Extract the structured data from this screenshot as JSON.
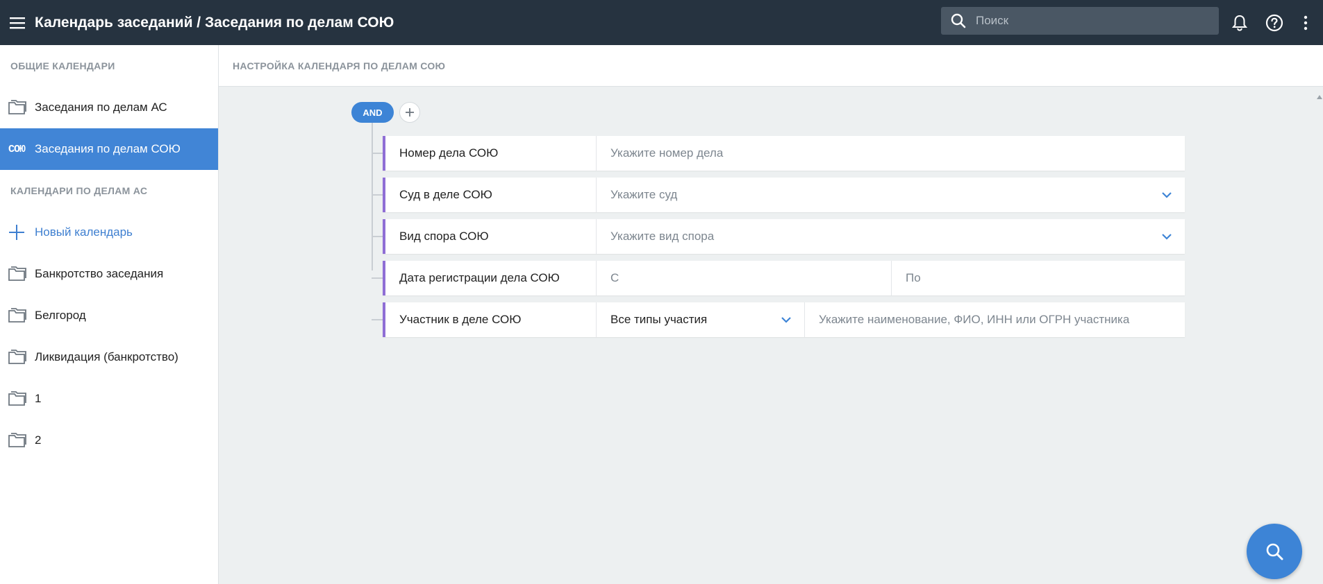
{
  "app": {
    "title": "Календарь заседаний / Заседания по делам СОЮ"
  },
  "search": {
    "placeholder": "Поиск"
  },
  "sidebar": {
    "general_header": "ОБЩИЕ КАЛЕНДАРИ",
    "general_items": [
      {
        "label": "Заседания по делам АС",
        "icon": "folder-icon"
      },
      {
        "label": "Заседания по делам СОЮ",
        "icon": "soyu-icon",
        "badge": "СОЮ",
        "active": true
      }
    ],
    "as_header": "КАЛЕНДАРИ ПО ДЕЛАМ АС",
    "new_calendar_label": "Новый календарь",
    "as_items": [
      {
        "label": "Банкротство заседания",
        "icon": "folder-icon"
      },
      {
        "label": "Белгород",
        "icon": "folder-icon"
      },
      {
        "label": "Ликвидация (банкротство)",
        "icon": "folder-icon"
      },
      {
        "label": "1",
        "icon": "folder-icon"
      },
      {
        "label": "2",
        "icon": "folder-icon"
      }
    ]
  },
  "main": {
    "header": "НАСТРОЙКА КАЛЕНДАРЯ ПО ДЕЛАМ СОЮ",
    "operator_label": "AND",
    "filters": {
      "case_number": {
        "label": "Номер дела СОЮ",
        "placeholder": "Укажите номер дела"
      },
      "court": {
        "label": "Суд в деле СОЮ",
        "placeholder": "Укажите суд"
      },
      "dispute_type": {
        "label": "Вид спора СОЮ",
        "placeholder": "Укажите вид спора"
      },
      "reg_date": {
        "label": "Дата регистрации дела СОЮ",
        "from_placeholder": "С",
        "to_placeholder": "По"
      },
      "participant": {
        "label": "Участник в деле СОЮ",
        "type_value": "Все типы участия",
        "placeholder": "Укажите наименование, ФИО, ИНН или ОГРН участника"
      }
    }
  },
  "colors": {
    "topbar": "#263340",
    "accent": "#3d84d6",
    "active_item": "#4185d6",
    "filter_stripe": "#8f6ed5",
    "main_bg": "#edf0f1"
  }
}
